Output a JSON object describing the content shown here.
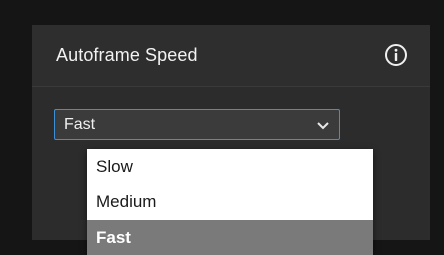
{
  "panel": {
    "title": "Autoframe Speed",
    "info_icon": "info-circle-icon"
  },
  "select": {
    "value": "Fast",
    "icon": "chevron-down-icon"
  },
  "dropdown": {
    "options": [
      {
        "label": "Slow",
        "selected": false
      },
      {
        "label": "Medium",
        "selected": false
      },
      {
        "label": "Fast",
        "selected": true
      }
    ]
  },
  "colors": {
    "focus_border": "#3d8fd6",
    "selected_option_bg": "#7a7a7a"
  }
}
